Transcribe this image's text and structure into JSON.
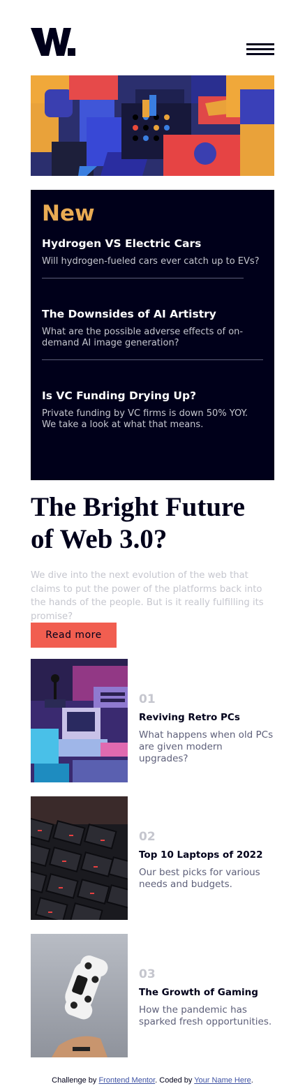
{
  "header": {
    "logo_alt": "W.",
    "menu_icon": "hamburger-menu-icon"
  },
  "new_section": {
    "title": "New",
    "items": [
      {
        "title": "Hydrogen VS Electric Cars",
        "description": "Will hydrogen-fueled cars ever catch up to EVs?"
      },
      {
        "title": "The Downsides of AI Artistry",
        "description": "What are the possible adverse effects of on-demand AI image generation?"
      },
      {
        "title": "Is VC Funding Drying Up?",
        "description": "Private funding by VC firms is down 50% YOY. We take a look at what that means."
      }
    ]
  },
  "feature": {
    "title": "The Bright Future of Web 3.0?",
    "description": "We dive into the next evolution of the web that claims to put the power of the platforms back into the hands of the people. But is it really fulfilling its promise?",
    "button_label": "Read more"
  },
  "articles": [
    {
      "number": "01",
      "title": "Reviving Retro PCs",
      "description": "What happens when old PCs are given modern upgrades?"
    },
    {
      "number": "02",
      "title": "Top 10 Laptops of 2022",
      "description": "Our best picks for various needs and budgets."
    },
    {
      "number": "03",
      "title": "The Growth of Gaming",
      "description": "How the pandemic has sparked fresh opportunities."
    }
  ],
  "footer": {
    "prefix": "Challenge by ",
    "challenge_link": "Frontend Mentor",
    "middle": ". Coded by ",
    "author_link": "Your Name Here",
    "suffix": "."
  },
  "colors": {
    "accent_red": "#f15e50",
    "accent_orange": "#e9ab53",
    "dark_navy": "#00001a",
    "grayish_blue": "#5d5f79",
    "light_gray": "#c5c6ce"
  }
}
